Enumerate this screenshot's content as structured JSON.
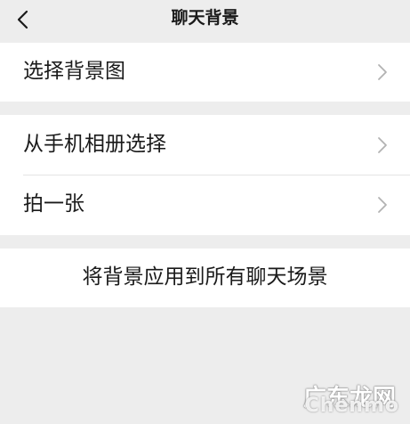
{
  "nav": {
    "title": "聊天背景",
    "back_icon": "chevron-left-icon"
  },
  "sections": {
    "choose_background": {
      "label": "选择背景图",
      "chevron_icon": "chevron-right-icon"
    },
    "from_album": {
      "label": "从手机相册选择",
      "chevron_icon": "chevron-right-icon"
    },
    "take_photo": {
      "label": "拍一张",
      "chevron_icon": "chevron-right-icon"
    },
    "apply_all": {
      "label": "将背景应用到所有聊天场景"
    }
  },
  "watermark": {
    "text": "广东龙网",
    "sub": "Chenmo"
  },
  "colors": {
    "background": "#ededed",
    "row_background": "#ffffff",
    "text": "#1a1a1a",
    "chevron": "#b2b2b2"
  }
}
